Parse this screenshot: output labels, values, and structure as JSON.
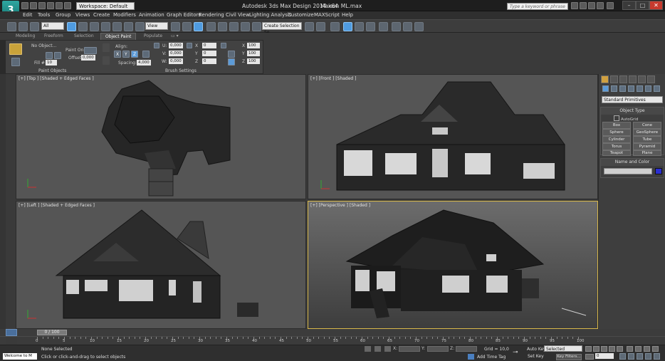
{
  "titlebar": {
    "logo_letter": "3",
    "workspace": "Workspace: Default",
    "app_title": "Autodesk 3ds Max Design 2014 x64",
    "file_title": "Maison ML.max",
    "search_placeholder": "Type a keyword or phrase"
  },
  "menu": [
    "Edit",
    "Tools",
    "Group",
    "Views",
    "Create",
    "Modifiers",
    "Animation",
    "Graph Editors",
    "Rendering",
    "Civil View",
    "Lighting Analysis",
    "Customize",
    "MAXScript",
    "Help"
  ],
  "toolbar": {
    "filter": "All",
    "refcoord": "View",
    "named_sel": "Create Selection Se"
  },
  "ribbon_tabs": [
    "Modeling",
    "Freeform",
    "Selection",
    "Object Paint",
    "Populate"
  ],
  "ribbon": {
    "no_object": "No Object...",
    "paint_on": "Paint On:",
    "offset_label": "Offset:",
    "offset_value": "0,000",
    "fill_label": "Fill #:",
    "fill_value": "10",
    "align_label": "Align:",
    "x": "X",
    "y": "Y",
    "z": "Z",
    "spacing_label": "Spacing:",
    "spacing_value": "4,000",
    "u_label": "U:",
    "u_value": "0,000",
    "v_label": "V:",
    "v_value": "0,000",
    "w_label": "W:",
    "w_value": "0,000",
    "rx_value": "0",
    "ry_value": "0",
    "rz_value": "0",
    "sx_value": "100",
    "sy_value": "100",
    "sz_value": "100",
    "group_paint_objects": "Paint Objects",
    "group_brush_settings": "Brush Settings"
  },
  "viewports": {
    "top": "[+] [Top ] [Shaded + Edged Faces ]",
    "front": "[+] [Front ] [Shaded ]",
    "left": "[+] [Left ] [Shaded + Edged Faces ]",
    "perspective": "[+] [Perspective ] [Shaded ]"
  },
  "command_panel": {
    "category": "Standard Primitives",
    "object_type": "Object Type",
    "autogrid": "AutoGrid",
    "buttons": [
      "Box",
      "Cone",
      "Sphere",
      "GeoSphere",
      "Cylinder",
      "Tube",
      "Torus",
      "Pyramid",
      "Teapot",
      "Plane"
    ],
    "name_and_color": "Name and Color",
    "swatch_color": "#2b2fd0"
  },
  "timeline": {
    "frame_range": "0 / 100",
    "ticks": [
      "0",
      "5",
      "10",
      "15",
      "20",
      "25",
      "30",
      "35",
      "40",
      "45",
      "50",
      "55",
      "60",
      "65",
      "70",
      "75",
      "80",
      "85",
      "90",
      "95",
      "100"
    ]
  },
  "status": {
    "maxscript": "Welcome to M",
    "selection": "None Selected",
    "prompt": "Click or click-and-drag to select objects",
    "x_label": "X:",
    "y_label": "Y:",
    "z_label": "Z:",
    "grid": "Grid = 10,0",
    "add_time_tag": "Add Time Tag",
    "auto_key": "Auto Key",
    "set_key": "Set Key",
    "selected": "Selected",
    "key_filters": "Key Filters...",
    "frame": "0"
  }
}
